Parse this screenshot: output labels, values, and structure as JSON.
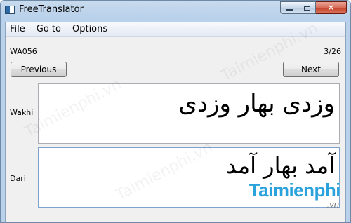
{
  "window": {
    "title": "FreeTranslator"
  },
  "caption_buttons": {
    "minimize_icon": "minimize-icon",
    "maximize_icon": "maximize-icon",
    "close_icon": "close-icon"
  },
  "menu": [
    "File",
    "Go to",
    "Options"
  ],
  "record": {
    "code": "WA056",
    "position": "3/26"
  },
  "nav": {
    "previous_label": "Previous",
    "next_label": "Next"
  },
  "fields": [
    {
      "language": "Wakhi",
      "text": "وزدی بهار وزدی"
    },
    {
      "language": "Dari",
      "text": "آمد بهار آمد"
    }
  ],
  "watermark": {
    "brand": "Taimienphi",
    "domain": ".vn",
    "faint": "Taimienphi.vn"
  }
}
